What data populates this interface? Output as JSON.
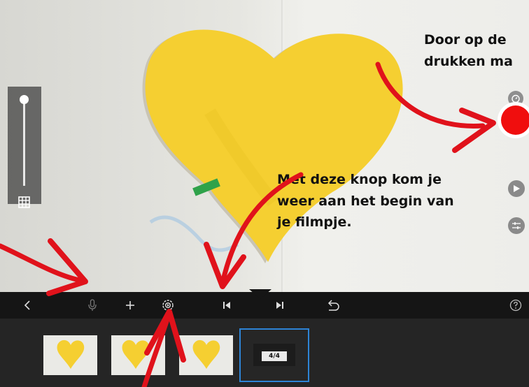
{
  "annotations": {
    "top_line1": "Door op de",
    "top_line2": "drukken ma",
    "middle_line1": "Met deze knop kom je",
    "middle_line2": "weer aan het begin van",
    "middle_line3": "je filmpje."
  },
  "toolbar": {
    "buttons": [
      "back-icon",
      "microphone-icon",
      "plus-icon",
      "settings-icon",
      "skip-to-start-icon",
      "skip-to-end-icon",
      "undo-icon",
      "help-icon"
    ]
  },
  "timeline": {
    "frame_counter": "4/4",
    "frames": 3
  },
  "colors": {
    "record": "#f00e0e",
    "selection": "#2d84d6",
    "annotation_arrow": "#e0121b",
    "heart": "#f5cf31"
  }
}
